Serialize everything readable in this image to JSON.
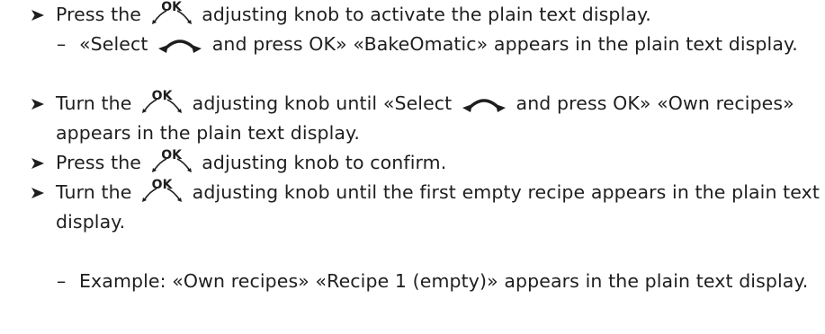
{
  "instructions": [
    {
      "kind": "step",
      "parts": [
        {
          "t": "text",
          "v": "Press the "
        },
        {
          "t": "knob"
        },
        {
          "t": "text",
          "v": " adjusting knob to activate the plain text display."
        }
      ]
    },
    {
      "kind": "sub",
      "parts": [
        {
          "t": "text",
          "v": "«Select "
        },
        {
          "t": "arc"
        },
        {
          "t": "text",
          "v": " and press OK» «BakeOmatic» appears in the plain text display."
        }
      ]
    },
    {
      "kind": "step",
      "parts": [
        {
          "t": "text",
          "v": "Turn the "
        },
        {
          "t": "knob"
        },
        {
          "t": "text",
          "v": " adjusting knob until «Select "
        },
        {
          "t": "arc"
        },
        {
          "t": "text",
          "v": " and press OK» «Own recipes» appears in the plain text display."
        }
      ]
    },
    {
      "kind": "step",
      "parts": [
        {
          "t": "text",
          "v": "Press the "
        },
        {
          "t": "knob"
        },
        {
          "t": "text",
          "v": " adjusting knob to confirm."
        }
      ]
    },
    {
      "kind": "step",
      "parts": [
        {
          "t": "text",
          "v": "Turn the "
        },
        {
          "t": "knob"
        },
        {
          "t": "text",
          "v": " adjusting knob until the first empty recipe appears in the plain text display."
        }
      ]
    },
    {
      "kind": "sub",
      "parts": [
        {
          "t": "text",
          "v": "Example: «Own recipes» «Recipe 1 (empty)» appears in the plain text display."
        }
      ]
    }
  ],
  "knob_label": "OK",
  "sub_marker": "–",
  "icons": {
    "step_marker": "arrow-right-icon",
    "knob": "ok-knob-icon",
    "select": "rotate-arc-icon"
  }
}
